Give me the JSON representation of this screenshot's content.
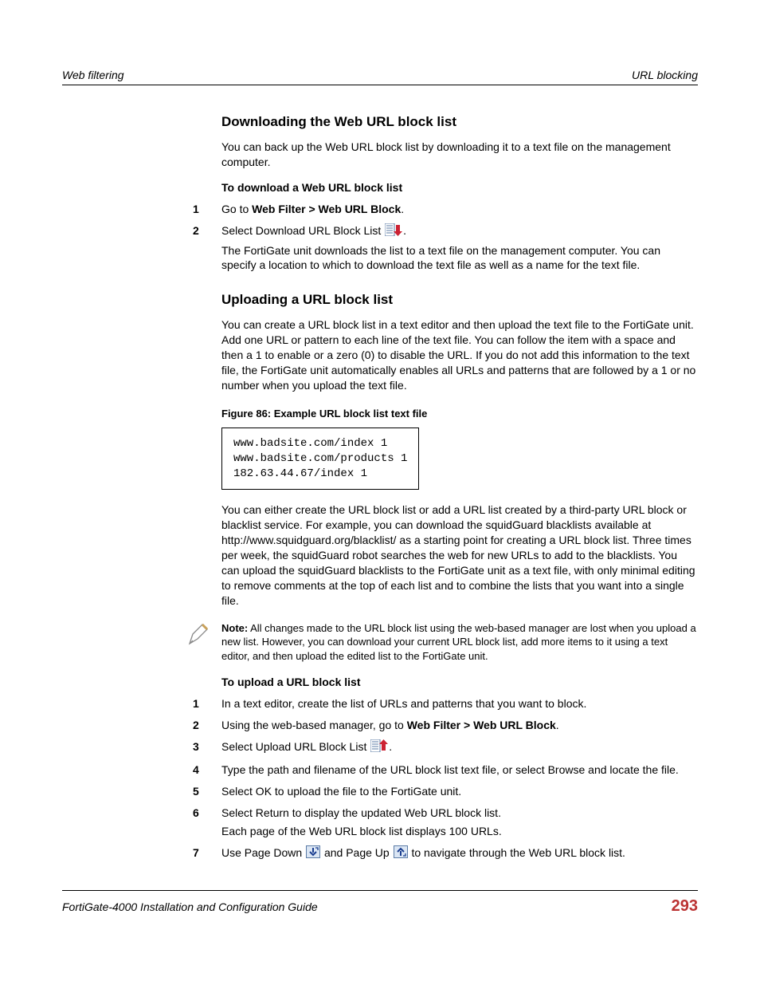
{
  "header": {
    "left": "Web filtering",
    "right": "URL blocking"
  },
  "section1": {
    "title": "Downloading the Web URL block list",
    "intro": "You can back up the Web URL block list by downloading it to a text file on the management computer.",
    "procTitle": "To download a Web URL block list",
    "steps": {
      "s1": {
        "num": "1",
        "pre": "Go to ",
        "bold": "Web Filter > Web URL Block",
        "post": "."
      },
      "s2": {
        "num": "2",
        "line": "Select Download URL Block List ",
        "after_icon": ".",
        "sub": "The FortiGate unit downloads the list to a text file on the management computer. You can specify a location to which to download the text file as well as a name for the text file."
      }
    }
  },
  "section2": {
    "title": "Uploading a URL block list",
    "intro": "You can create a URL block list in a text editor and then upload the text file to the FortiGate unit. Add one URL or pattern to each line of the text file. You can follow the item with a space and then a 1 to enable or a zero (0) to disable the URL. If you do not add this information to the text file, the FortiGate unit automatically enables all URLs and patterns that are followed by a 1 or no number when you upload the text file.",
    "figureCaption": "Figure 86: Example URL block list text file",
    "code": "www.badsite.com/index 1\nwww.badsite.com/products 1\n182.63.44.67/index 1",
    "after": "You can either create the URL block list or add a URL list created by a third-party URL block or blacklist service. For example, you can download the squidGuard blacklists available at http://www.squidguard.org/blacklist/ as a starting point for creating a URL block list. Three times per week, the squidGuard robot searches the web for new URLs to add to the blacklists. You can upload the squidGuard blacklists to the FortiGate unit as a text file, with only minimal editing to remove comments at the top of each list and to combine the lists that you want into a single file.",
    "note": {
      "label": "Note:",
      "text": " All changes made to the URL block list using the web-based manager are lost when you upload a new list. However, you can download your current URL block list, add more items to it using a text editor, and then upload the edited list to the FortiGate unit."
    },
    "procTitle": "To upload a URL block list",
    "steps": {
      "s1": {
        "num": "1",
        "text": "In a text editor, create the list of URLs and patterns that you want to block."
      },
      "s2": {
        "num": "2",
        "pre": "Using the web-based manager, go to ",
        "bold": "Web Filter > Web URL Block",
        "post": "."
      },
      "s3": {
        "num": "3",
        "line": "Select Upload URL Block List ",
        "after_icon": "."
      },
      "s4": {
        "num": "4",
        "text": "Type the path and filename of the URL block list text file, or select Browse and locate the file."
      },
      "s5": {
        "num": "5",
        "text": "Select OK to upload the file to the FortiGate unit."
      },
      "s6": {
        "num": "6",
        "text": "Select Return to display the updated Web URL block list.",
        "sub": "Each page of the Web URL block list displays 100 URLs."
      },
      "s7": {
        "num": "7",
        "pre": "Use Page Down ",
        "mid": " and Page Up ",
        "post": " to navigate through the Web URL block list."
      }
    }
  },
  "footer": {
    "left": "FortiGate-4000 Installation and Configuration Guide",
    "page": "293"
  }
}
